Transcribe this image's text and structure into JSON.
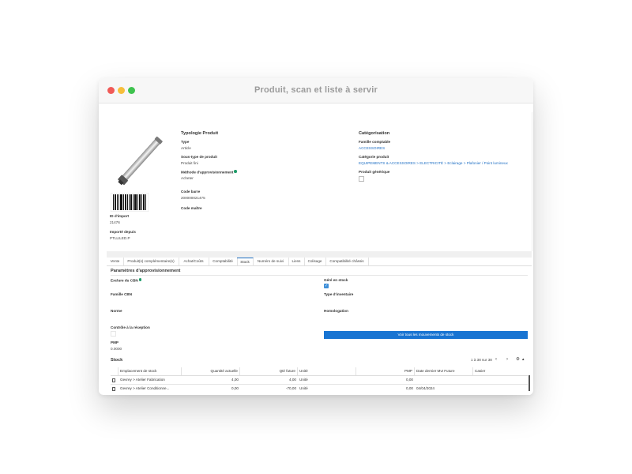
{
  "window": {
    "title": "Produit, scan et liste à servir"
  },
  "product": {
    "id_import_label": "ID d'import",
    "id_import_value": "21476",
    "imported_from_label": "Importé depuis",
    "imported_from_value": "PTLLILED.P"
  },
  "typologie": {
    "heading": "Typologie Produit",
    "type_label": "Type",
    "type_value": "Article",
    "soustype_label": "Sous-type de produit",
    "soustype_value": "Produit fini",
    "methode_label": "Méthode d'approvisionnement",
    "methode_value": "Acheter",
    "code_barre_label": "Code barre",
    "code_barre_value": "200000021475",
    "code_maitre_label": "Code maître"
  },
  "categorisation": {
    "heading": "Catégorisation",
    "famille_label": "Famille comptable",
    "famille_value": "ACCESSOIRES",
    "categorie_label": "Catégorie produit",
    "categorie_value": "EQUIPEMENTS & ACCESSOIRES > ELECTRICITÉ > Eclairage > Plafonier / Point lumineux",
    "generique_label": "Produit générique"
  },
  "tabs": [
    "Vente",
    "Produit(s) complémentaire(s)",
    "Achat/Coûts",
    "Comptabilité",
    "Stock",
    "Numéro de suivi",
    "Liens",
    "Colisage",
    "Compatibilité châssis"
  ],
  "appro": {
    "heading": "Paramètres d'approvisionnement",
    "exclure_label": "Exclure du CBN",
    "gere_label": "Géré en stock",
    "famille_cbn_label": "Famille CBN",
    "type_inventaire_label": "Type d'inventaire",
    "norme_label": "Norme",
    "homologation_label": "Homologation",
    "controle_label": "Contrôle à la réception",
    "button_label": "Voir tous les mouvements de stock",
    "pmp_label": "PMP",
    "pmp_value": "0.0000"
  },
  "stock": {
    "heading": "Stock",
    "pagination": "1 à 38 sur 38",
    "prev_icon": "‹",
    "next_icon": "›",
    "settings_icon": "⚙",
    "collapse_icon": "▲",
    "columns": [
      "Emplacement de stock",
      "Quantité actuelle",
      "Qté future",
      "Unité",
      "PMP",
      "Date dernier Mvt Future",
      "Casier"
    ],
    "rows": [
      {
        "emplacement": "Gevrey > Atelier Fabrication",
        "quantite": "4,00",
        "qte_future": "4,00",
        "unite": "Unité",
        "pmp": "0,00",
        "date": "",
        "casier": ""
      },
      {
        "emplacement": "Gevrey > Atelier Conditionne...",
        "quantite": "0,00",
        "qte_future": "-70,00",
        "unite": "Unité",
        "pmp": "0,00",
        "date": "04/04/2024",
        "casier": ""
      }
    ]
  }
}
